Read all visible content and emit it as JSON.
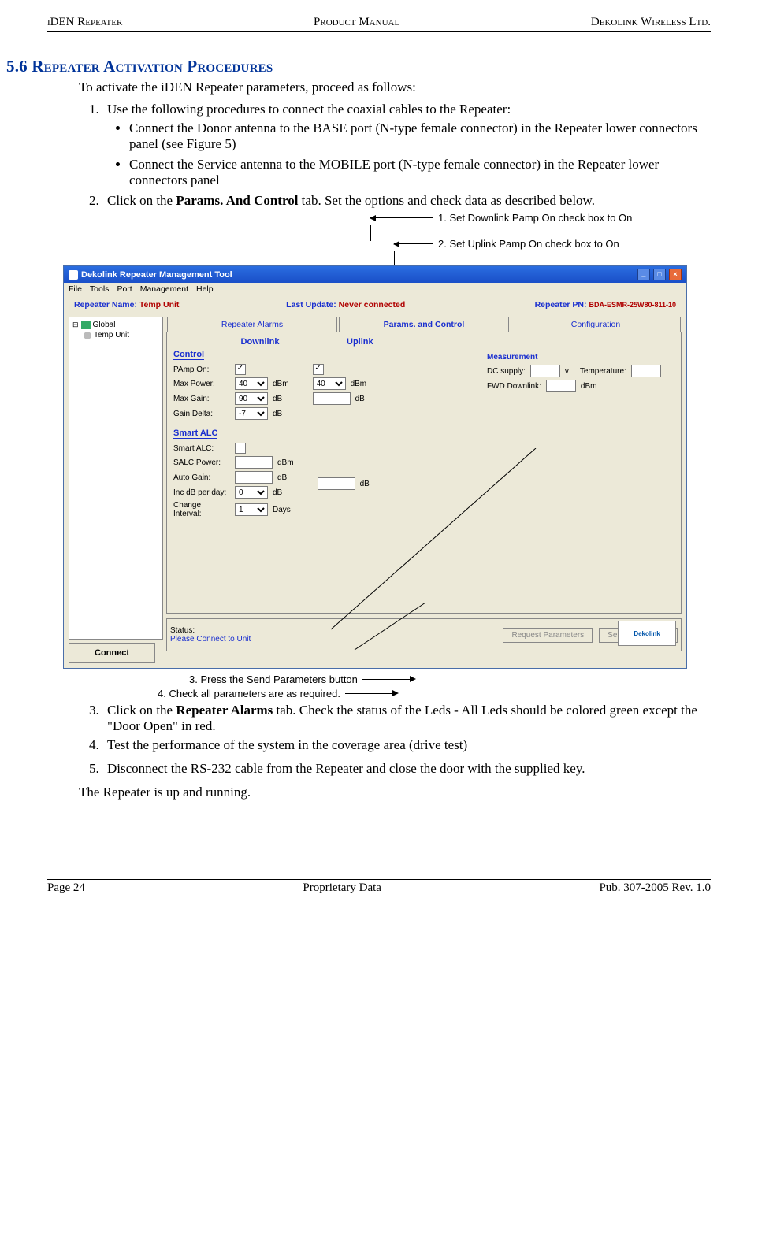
{
  "header": {
    "left": "iDEN Repeater",
    "center": "Product Manual",
    "right": "Dekolink Wireless Ltd."
  },
  "section": {
    "number": "5.6",
    "title": "Repeater Activation Procedures"
  },
  "intro": "To activate the iDEN Repeater parameters, proceed as follows:",
  "steps": {
    "s1": "Use the following procedures to connect the coaxial cables to the Repeater:",
    "s1a": "Connect the Donor antenna to the BASE port (N-type female connector) in the Repeater lower connectors panel (see Figure 5)",
    "s1b": "Connect the Service antenna to the MOBILE port (N-type female connector) in the Repeater lower connectors panel",
    "s2a": "Click on the ",
    "s2b": "Params. And Control",
    "s2c": " tab.  Set the options and check data as described below.",
    "s3a": "Click on the ",
    "s3b": "Repeater Alarms",
    "s3c": " tab.  Check the status of the Leds - All Leds should be colored green except the \"Door Open\" in red.",
    "s4": "Test the performance of the system in the coverage area (drive test)",
    "s5": "Disconnect the RS-232 cable from the Repeater and close the door with the supplied key."
  },
  "closing": "The Repeater is up and running.",
  "callouts": {
    "c1": "1. Set Downlink Pamp On check box  to On",
    "c2": "2. Set Uplink Pamp On check box  to On",
    "c3": "3. Press the Send Parameters button",
    "c4": "4. Check all parameters are as required."
  },
  "window": {
    "title": "Dekolink Repeater Management Tool",
    "menu": [
      "File",
      "Tools",
      "Port",
      "Management",
      "Help"
    ],
    "repeater_name_label": "Repeater Name:",
    "repeater_name_value": "Temp Unit",
    "last_update_label": "Last Update:",
    "last_update_value": "Never connected",
    "repeater_pn_label": "Repeater PN:",
    "repeater_pn_value": "BDA-ESMR-25W80-811-10",
    "tree": {
      "root": "Global",
      "child": "Temp Unit"
    },
    "tabs": [
      "Repeater Alarms",
      "Params. and Control",
      "Configuration"
    ],
    "sub_downlink": "Downlink",
    "sub_uplink": "Uplink",
    "groups": {
      "control": "Control",
      "smart_alc": "Smart ALC",
      "measurement": "Measurement"
    },
    "fields": {
      "pamp_on": "PAmp On:",
      "max_power": "Max Power:",
      "max_gain": "Max Gain:",
      "gain_delta": "Gain Delta:",
      "smart_alc_f": "Smart ALC:",
      "salc_power": "SALC Power:",
      "auto_gain": "Auto Gain:",
      "inc_db": "Inc dB per day:",
      "change_interval": "Change Interval:",
      "dc_supply": "DC supply:",
      "temperature": "Temperature:",
      "fwd_downlink": "FWD Downlink:"
    },
    "values": {
      "dl_max_power": "40",
      "ul_max_power": "40",
      "dl_max_gain": "90",
      "dl_gain_delta": "-7",
      "inc_db": "0",
      "change_interval": "1"
    },
    "units": {
      "dbm": "dBm",
      "db": "dB",
      "days": "Days",
      "v": "v"
    },
    "status_label": "Status:",
    "status_value": "Please Connect to Unit",
    "buttons": {
      "connect": "Connect",
      "request": "Request Parameters",
      "send": "Send Parameters"
    },
    "logo": "Dekolink"
  },
  "footer": {
    "left": "Page 24",
    "center": "Proprietary Data",
    "right": "Pub. 307-2005 Rev. 1.0"
  }
}
